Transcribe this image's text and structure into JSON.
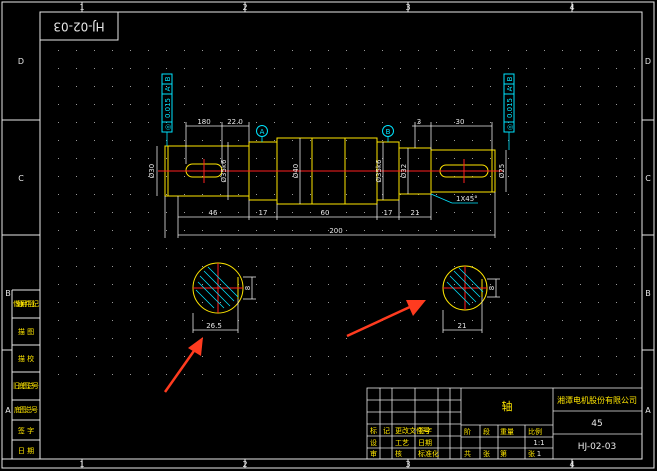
{
  "drawing": {
    "mirrored_code": "HJ-02-03",
    "border_numbers": {
      "top": [
        "1",
        "2",
        "3",
        "4"
      ],
      "bottom": [
        "1",
        "2",
        "3",
        "4"
      ]
    },
    "border_letters": {
      "left": [
        "D",
        "C",
        "B",
        "A"
      ],
      "right": [
        "D",
        "C",
        "B",
        "A"
      ]
    },
    "left_strip": [
      "借(通)用件登记",
      "描 图",
      "描 校",
      "旧底图总号",
      "底图总号",
      "签 字",
      "日 期"
    ],
    "datum_a": "A",
    "datum_b": "B",
    "tolerance_frame": [
      "◎",
      "0.015",
      "A",
      "B"
    ],
    "dims": {
      "d180": "180",
      "d220": "22.0",
      "d3": "3",
      "d30": "30",
      "d46": "46",
      "d17a": "17",
      "d60": "60",
      "d17b": "17",
      "d21": "21",
      "d200": "200",
      "dia30": "Ø30",
      "dia35a": "Ø35k6",
      "dia40": "Ø40",
      "dia35b": "Ø35k6",
      "dia32": "Ø32",
      "dia25": "Ø25",
      "chamfer": "1X45°",
      "sec1_depth": "26.5",
      "sec1_width": "8",
      "sec2_depth": "21",
      "sec2_width": "8"
    },
    "title_block": {
      "name": "轴",
      "company": "湘潭电机股份有限公司",
      "material": "45",
      "code": "HJ-02-03",
      "scale": "1:1",
      "weight": "",
      "sheet": "1"
    },
    "annotation_color": "#ff3b1f"
  }
}
